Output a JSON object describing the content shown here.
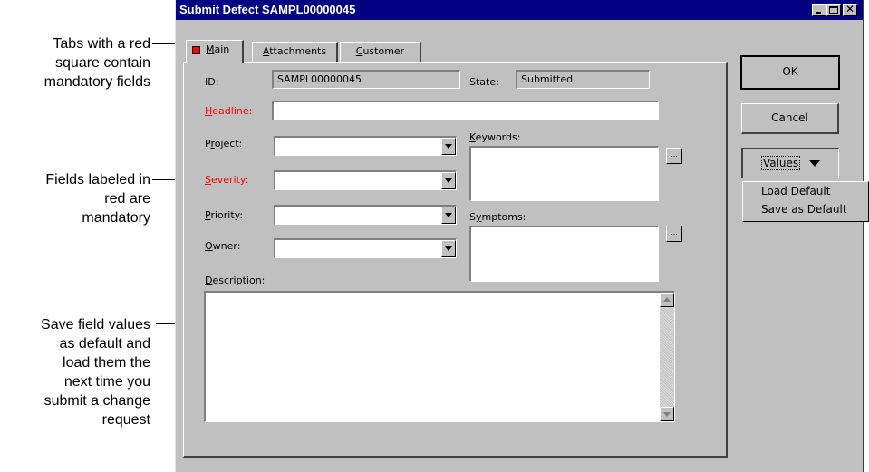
{
  "callouts": {
    "tabs_note": [
      "Tabs with a red",
      "square contain",
      "mandatory fields"
    ],
    "red_note": [
      "Fields labeled in",
      "red are",
      "mandatory"
    ],
    "save_note": [
      "Save field values",
      "as default and",
      "load them the",
      "next time you",
      "submit a change",
      "request"
    ]
  },
  "dialog": {
    "title": "Submit Defect SAMPL00000045",
    "tabs": [
      {
        "label": "Main",
        "mnemonic": "M",
        "rest": "ain",
        "active": true,
        "mandatory_marker": true
      },
      {
        "label": "Attachments",
        "mnemonic": "A",
        "rest": "ttachments"
      },
      {
        "label": "Customer",
        "mnemonic": "C",
        "rest": "ustomer"
      }
    ],
    "fields": {
      "id": {
        "label": "ID:",
        "value": "SAMPL00000045"
      },
      "state": {
        "label": "State:",
        "value": "Submitted"
      },
      "headline": {
        "label_m": "H",
        "label_rest": "eadline:",
        "value": ""
      },
      "project": {
        "label_pre": "P",
        "label_m": "r",
        "label_rest": "oject:",
        "value": ""
      },
      "severity": {
        "label_m": "S",
        "label_rest": "everity:",
        "value": ""
      },
      "priority": {
        "label_m": "P",
        "label_rest": "riority:",
        "value": ""
      },
      "owner": {
        "label_m": "O",
        "label_rest": "wner:",
        "value": ""
      },
      "keywords": {
        "label_m": "K",
        "label_rest": "eywords:",
        "value": ""
      },
      "symptoms": {
        "label_pre": "S",
        "label_m": "y",
        "label_rest": "mptoms:",
        "value": ""
      },
      "description": {
        "label_m": "D",
        "label_rest": "escription:",
        "value": ""
      }
    },
    "buttons": {
      "ok": "OK",
      "cancel": "Cancel",
      "values": "Values",
      "ellipsis": "..."
    },
    "values_menu": [
      "Load Default",
      "Save as Default"
    ],
    "colors": {
      "title_bg": "#000080",
      "required_label": "#ff0000",
      "face": "#c0c0c0"
    }
  }
}
